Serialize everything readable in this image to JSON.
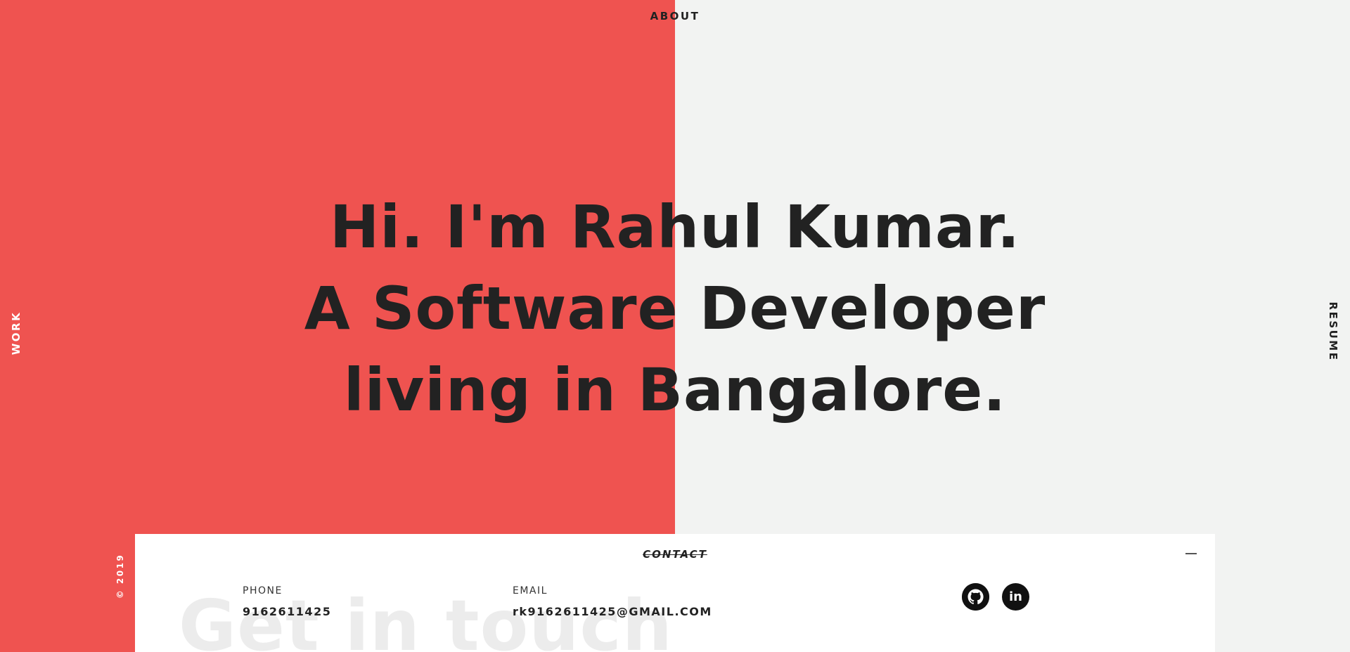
{
  "nav": {
    "about": "ABOUT",
    "work": "WORK",
    "resume": "RESUME"
  },
  "hero": {
    "line1": "Hi. I'm Rahul Kumar.",
    "line2": "A Software Developer",
    "line3": "living in Bangalore."
  },
  "footer": {
    "copyright": "© 2019"
  },
  "contact": {
    "title": "CONTACT",
    "background_text": "Get in touch",
    "phone_label": "PHONE",
    "phone_value": "9162611425",
    "email_label": "EMAIL",
    "email_value": "rk9162611425@GMAIL.COM",
    "social": [
      {
        "icon": "github-icon"
      },
      {
        "icon": "linkedin-icon",
        "glyph": "in"
      }
    ]
  },
  "colors": {
    "accent": "#ef5350",
    "light_bg": "#f2f3f2",
    "text": "#222222",
    "card": "#ffffff"
  }
}
